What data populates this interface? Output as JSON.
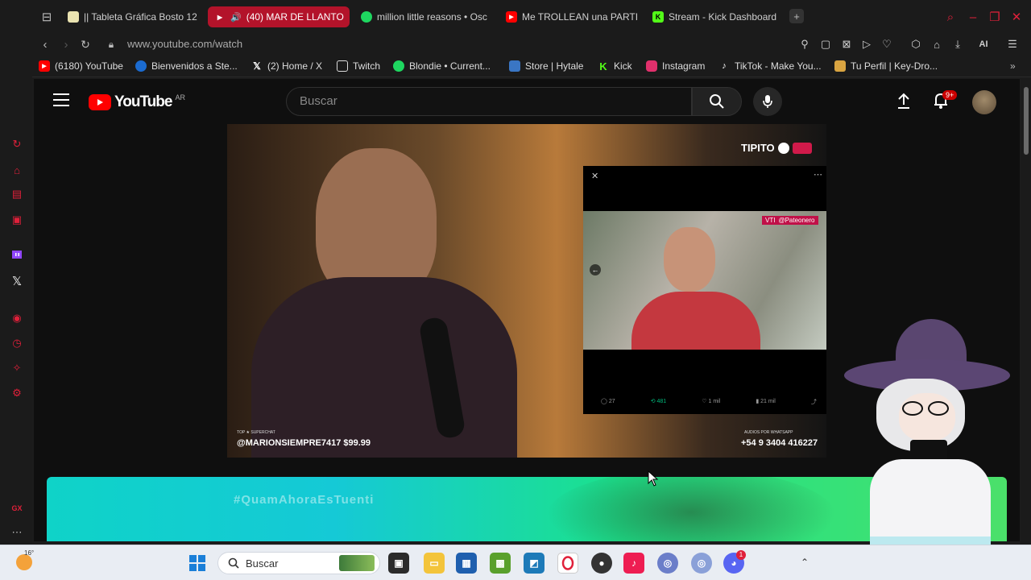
{
  "tabs": [
    {
      "label": "|| Tableta Gráfica Bosto 12",
      "color": "#e9e2b0"
    },
    {
      "label": "(40) MAR DE LLANTO",
      "color": "#ff0000",
      "active": true
    },
    {
      "label": "million little reasons • Osc",
      "color": "#1ed760"
    },
    {
      "label": "Me TROLLEAN una PARTI",
      "color": "#ff0000"
    },
    {
      "label": "Stream - Kick Dashboard",
      "color": "#53fc18"
    }
  ],
  "new_tab_label": "+",
  "address": {
    "url": "www.youtube.com/watch",
    "ai_label": "AI"
  },
  "bookmarks": [
    {
      "label": "(6180) YouTube",
      "color": "#ff0000"
    },
    {
      "label": "Bienvenidos a Ste...",
      "color": "#1b6bd0"
    },
    {
      "label": "(2) Home / X",
      "color": "#000000"
    },
    {
      "label": "Twitch",
      "color": "#9146ff"
    },
    {
      "label": "Blondie • Current...",
      "color": "#1ed760"
    },
    {
      "label": "Store | Hytale",
      "color": "#3a76c4"
    },
    {
      "label": "Kick",
      "color": "#53fc18"
    },
    {
      "label": "Instagram",
      "color": "#e1306c"
    },
    {
      "label": "TikTok - Make You...",
      "color": "#111111"
    },
    {
      "label": "Tu Perfil | Key-Dro...",
      "color": "#d9a441"
    }
  ],
  "youtube": {
    "logo_text": "YouTube",
    "region": "AR",
    "search_placeholder": "Buscar",
    "notification_count": "9+"
  },
  "video": {
    "channel_watermark": "TIPITO",
    "superchat_label": "TOP ★ SUPERCHAT",
    "superchat_user": "@MARIONSIEMPRE7417 $99.99",
    "contact_label": "AUDIOS POR WHATSAPP",
    "phone": "+54 9 3404 416227",
    "tweet_handle": "@Pateonero",
    "tweet_tag": "VTI",
    "tweet_stats": [
      "27",
      "481",
      "1 mil",
      "21 mil"
    ]
  },
  "banner": {
    "hashtag": "#QuamAhoraEsTuenti"
  },
  "taskbar": {
    "weather": "16°",
    "search_placeholder": "Buscar",
    "badge": "1"
  },
  "sidebar": {
    "extra_label": "GX"
  }
}
